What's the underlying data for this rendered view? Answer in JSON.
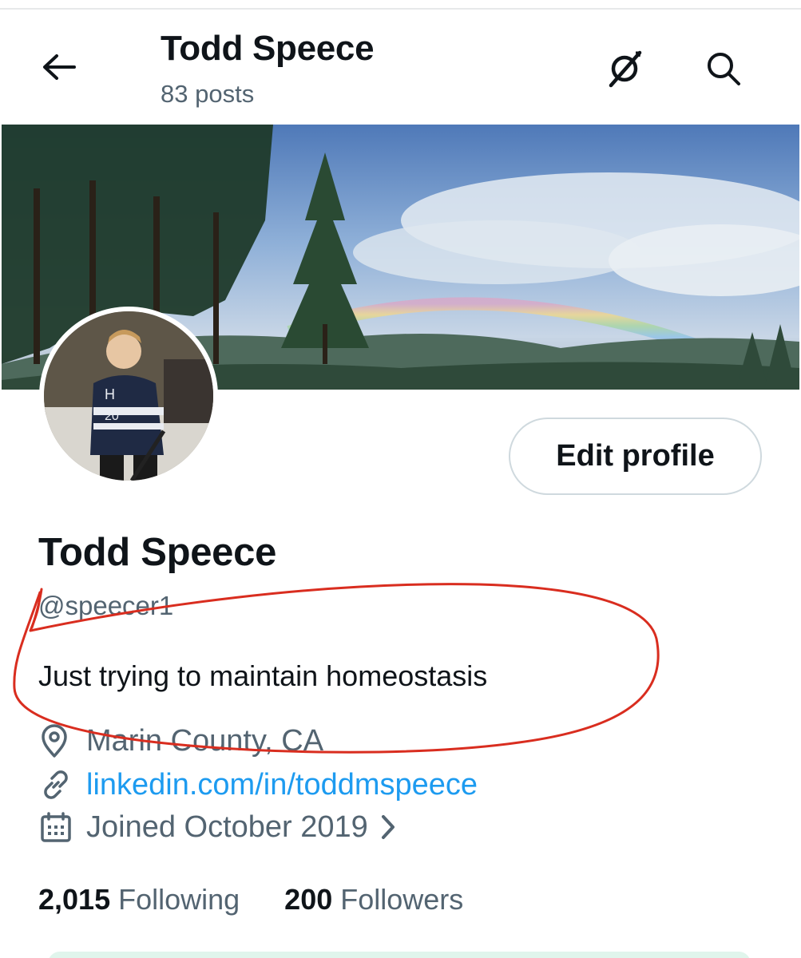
{
  "header": {
    "title": "Todd Speece",
    "subtitle": "83 posts"
  },
  "profile": {
    "display_name": "Todd Speece",
    "handle": "@speecer1",
    "bio": "Just trying to maintain homeostasis",
    "location": "Marin County, CA",
    "website": "linkedin.com/in/toddmspeece",
    "joined": "Joined October 2019",
    "edit_button_label": "Edit profile"
  },
  "stats": {
    "following_count": "2,015",
    "following_label": "Following",
    "followers_count": "200",
    "followers_label": "Followers"
  },
  "colors": {
    "link": "#1d9bf0",
    "secondary_text": "#536471",
    "annotation": "#d92d1f"
  },
  "icons": [
    "back-arrow-icon",
    "grok-icon",
    "search-icon",
    "location-pin-icon",
    "link-icon",
    "calendar-icon",
    "chevron-right-icon"
  ]
}
